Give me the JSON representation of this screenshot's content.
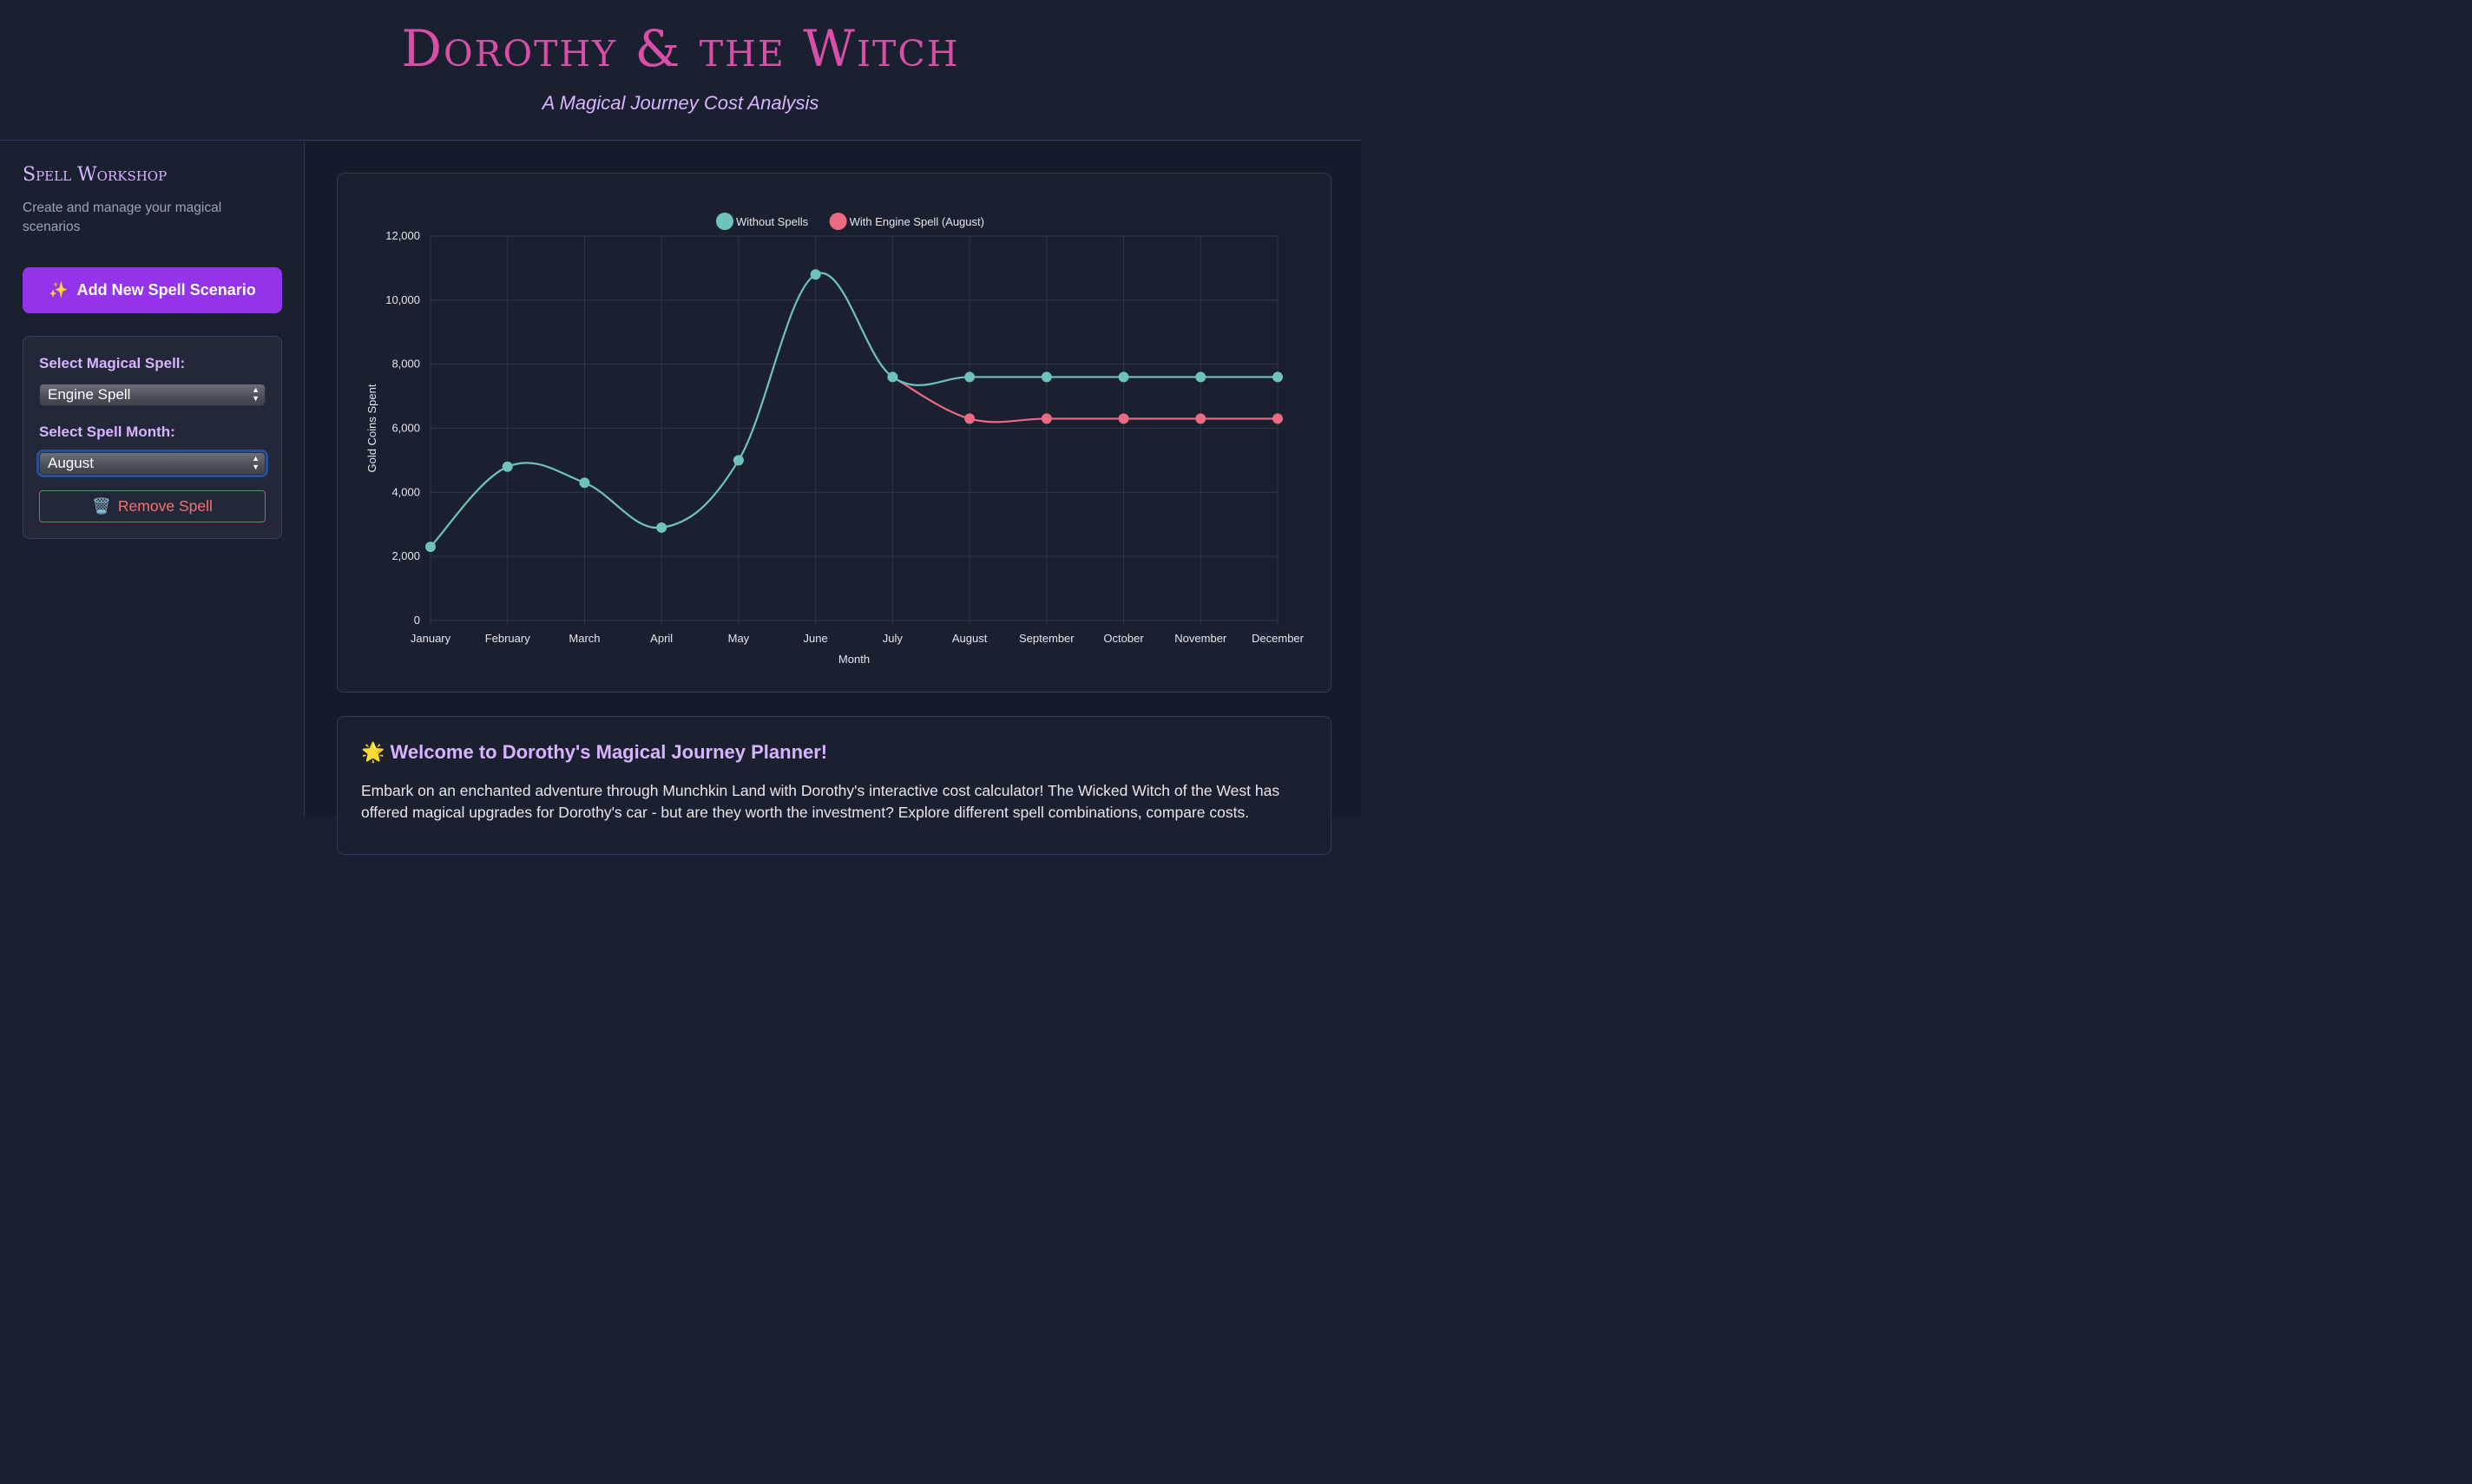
{
  "header": {
    "title": "Dorothy & the Witch",
    "subtitle": "A Magical Journey Cost Analysis"
  },
  "sidebar": {
    "title": "Spell Workshop",
    "description": "Create and manage your magical scenarios",
    "add_button": {
      "icon": "sparkles-icon",
      "glyph": "✨",
      "label": "Add New Spell Scenario"
    },
    "scenario": {
      "spell_label": "Select Magical Spell:",
      "spell_value": "Engine Spell",
      "month_label": "Select Spell Month:",
      "month_value": "August",
      "remove_button": {
        "icon": "trash-icon",
        "glyph": "🗑️",
        "label": "Remove Spell"
      }
    }
  },
  "welcome": {
    "icon": "star-icon",
    "glyph": "🌟",
    "title": "Welcome to Dorothy's Magical Journey Planner!",
    "text": "Embark on an enchanted adventure through Munchkin Land with Dorothy's interactive cost calculator! The Wicked Witch of the West has offered magical upgrades for Dorothy's car - but are they worth the investment? Explore different spell combinations, compare costs."
  },
  "colors": {
    "title": "#d94fa8",
    "accent": "#9333ea",
    "series_without": "#6ec3bd",
    "series_with": "#ec6a82"
  },
  "chart_data": {
    "type": "line",
    "xlabel": "Month",
    "ylabel": "Gold Coins Spent",
    "ylim": [
      0,
      12000
    ],
    "yticks": [
      0,
      2000,
      4000,
      6000,
      8000,
      10000,
      12000
    ],
    "ytick_labels": [
      "0",
      "2,000",
      "4,000",
      "6,000",
      "8,000",
      "10,000",
      "12,000"
    ],
    "grid": true,
    "legend": "top-center",
    "categories": [
      "January",
      "February",
      "March",
      "April",
      "May",
      "June",
      "July",
      "August",
      "September",
      "October",
      "November",
      "December"
    ],
    "series": [
      {
        "name": "Without Spells",
        "color": "#6ec3bd",
        "values": [
          2300,
          4800,
          4300,
          2900,
          5000,
          10800,
          7600,
          7600,
          7600,
          7600,
          7600,
          7600
        ]
      },
      {
        "name": "With Engine Spell (August)",
        "color": "#ec6a82",
        "values": [
          null,
          null,
          null,
          null,
          null,
          null,
          7600,
          6300,
          6300,
          6300,
          6300,
          6300
        ]
      }
    ]
  }
}
